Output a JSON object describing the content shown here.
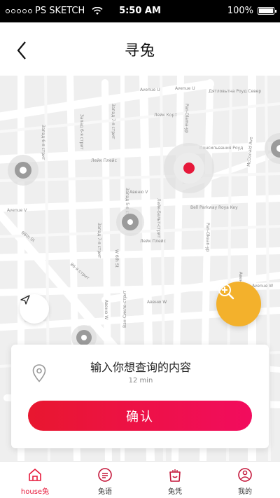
{
  "status_bar": {
    "carrier": "PS SKETCH",
    "time": "5:50 AM",
    "battery": "100%"
  },
  "header": {
    "title": "寻兔"
  },
  "map": {
    "street_labels": [
      "Avenue U",
      "Avenue U",
      "Дятловьтна Роуд Север",
      "Запад 6-я стрит",
      "Запад 6-я стрит",
      "Запад 7-я стрит",
      "Лейк Корт",
      "Пенсильвания Роуд",
      "Pan-Dlama-yp",
      "Лейк Плейс",
      "Авеню V",
      "Avenue V",
      "McDonald Ave",
      "Bell Parkway Roya Key",
      "86th St",
      "Pan-Okean-yp",
      "Запад 7-я стрит",
      "Запад 5-я стрит",
      "W 6th St",
      "Лейк Плейс",
      "86-я стрит",
      "Avenue W",
      "Авеню",
      "Ван-Сикле-стрит",
      "Лейк-Бельт-стрит",
      "Авеню W",
      "Авеню W"
    ]
  },
  "search": {
    "placeholder": "输入你想查询的内容",
    "duration": "12 min",
    "confirm_label": "确认"
  },
  "tabs": [
    {
      "label": "house兔",
      "icon": "home-icon",
      "active": true
    },
    {
      "label": "兔语",
      "icon": "chat-icon",
      "active": false
    },
    {
      "label": "兔凭",
      "icon": "bag-icon",
      "active": false
    },
    {
      "label": "我的",
      "icon": "profile-icon",
      "active": false
    }
  ],
  "colors": {
    "accent": "#e6183a",
    "zoom_button": "#f3b12c",
    "marker_selected": "#e6183a"
  }
}
